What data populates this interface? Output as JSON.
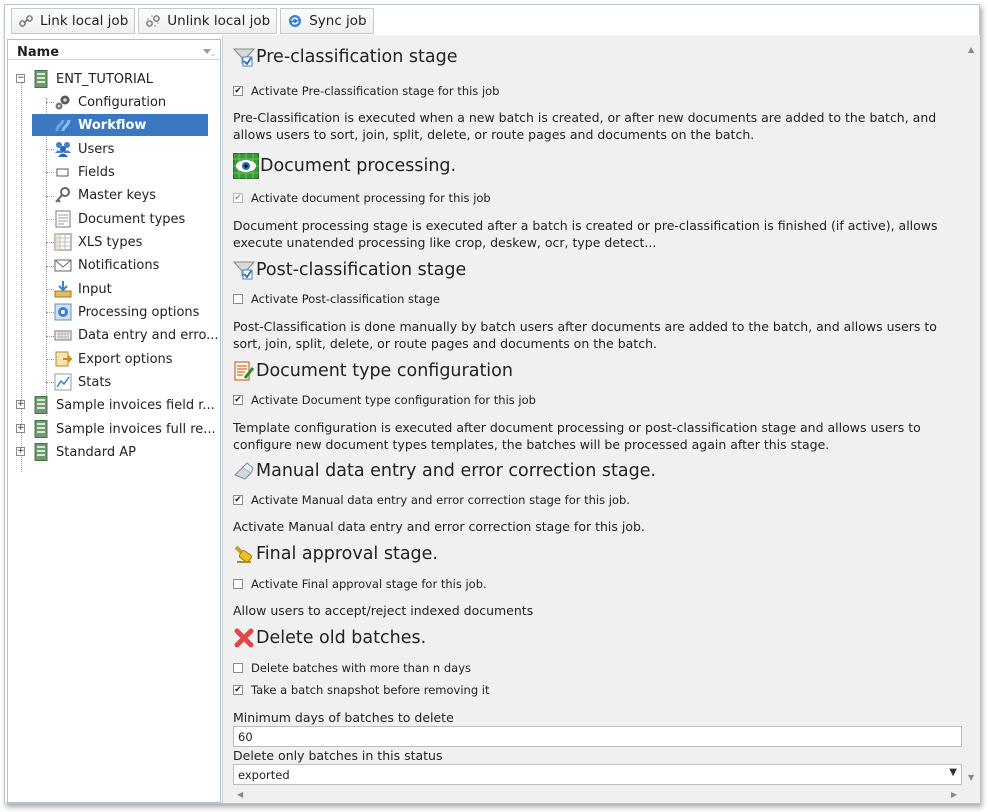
{
  "toolbar": {
    "link_label": "Link local job",
    "unlink_label": "Unlink local job",
    "sync_label": "Sync job"
  },
  "tree": {
    "header": "Name",
    "root": "ENT_TUTORIAL",
    "children": [
      {
        "label": "Configuration",
        "icon": "gears-icon"
      },
      {
        "label": "Workflow",
        "icon": "workflow-icon"
      },
      {
        "label": "Users",
        "icon": "users-icon"
      },
      {
        "label": "Fields",
        "icon": "field-icon"
      },
      {
        "label": "Master keys",
        "icon": "key-icon"
      },
      {
        "label": "Document types",
        "icon": "document-types-icon"
      },
      {
        "label": "XLS types",
        "icon": "spreadsheet-icon"
      },
      {
        "label": "Notifications",
        "icon": "envelope-icon"
      },
      {
        "label": "Input",
        "icon": "input-tray-icon"
      },
      {
        "label": "Processing options",
        "icon": "processing-icon"
      },
      {
        "label": "Data entry and erro...",
        "icon": "keyboard-icon"
      },
      {
        "label": "Export options",
        "icon": "export-icon"
      },
      {
        "label": "Stats",
        "icon": "stats-icon"
      }
    ],
    "siblings": [
      {
        "label": "Sample invoices field r..."
      },
      {
        "label": "Sample invoices full re..."
      },
      {
        "label": "Standard AP"
      }
    ],
    "selected": "Workflow"
  },
  "sections": {
    "preclass": {
      "title": "Pre-classification stage",
      "checkbox": "Activate Pre-classification stage for this job",
      "checked": true,
      "description": "Pre-Classification is executed when a new batch is created, or after new documents are added to the batch, and allows users to sort, join, split, delete, or route pages and documents on the batch."
    },
    "docproc": {
      "title": "Document processing.",
      "checkbox": "Activate document processing for this job",
      "checked": true,
      "disabled": true,
      "description": "Document processing stage is executed after a batch is created or pre-classification is finished (if active), allows execute unatended processing like crop, deskew, ocr, type detect..."
    },
    "postclass": {
      "title": "Post-classification stage",
      "checkbox": "Activate Post-classification stage",
      "checked": false,
      "description": "Post-Classification is done manually by batch users after documents are added to the batch, and allows users to sort, join, split, delete, or route pages and documents on the batch."
    },
    "doctype": {
      "title": "Document type configuration",
      "checkbox": "Activate Document type configuration for this job",
      "checked": true,
      "description": "Template configuration is executed after document processing or post-classification stage and allows users to configure new document types templates, the batches will be processed again after this stage."
    },
    "manual": {
      "title": "Manual data entry and error correction stage.",
      "checkbox": "Activate Manual data entry and error correction stage for this job.",
      "checked": true,
      "description": "Activate Manual data entry and error correction stage for this job."
    },
    "final": {
      "title": "Final approval stage.",
      "checkbox": "Activate Final approval stage for this job.",
      "checked": false,
      "description": "Allow users to accept/reject indexed documents"
    },
    "delete": {
      "title": "Delete old batches.",
      "checkbox1": "Delete batches with more than n days",
      "checked1": false,
      "checkbox2": "Take a batch snapshot before removing it",
      "checked2": true,
      "min_days_label": "Minimum days of batches to delete",
      "min_days_value": "60",
      "status_label": "Delete only batches in this status",
      "status_value": "exported"
    }
  },
  "check_mark": "✔"
}
